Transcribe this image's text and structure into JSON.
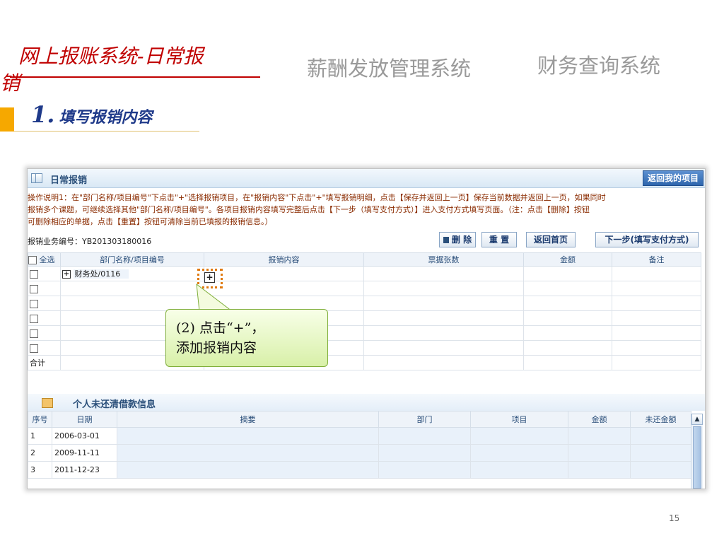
{
  "slide": {
    "title_line1": "网上报账系统-日常报",
    "title_line2": "销",
    "tab_salary": "薪酬发放管理系统",
    "tab_finance": "财务查询系统",
    "section_number": "1.",
    "section_title": "填写报销内容",
    "page_number": "15"
  },
  "panel": {
    "title": "日常报销",
    "return_button": "返回我的项目",
    "instructions": [
      "操作说明1：在\"部门名称/项目编号\"下点击\"+\"选择报销项目，在\"报销内容\"下点击\"+\"填写报销明细，点击【保存并返回上一页】保存当前数据并返回上一页，如果同时",
      "报销多个课题，可继续选择其他\"部门名称/项目编号\"。各项目报销内容填写完整后点击【下一步（填写支付方式）】进入支付方式填写页面。（注：点击【删除】按钮",
      "可删除相应的单据，点击【重置】按钮可清除当前已填报的报销信息。）"
    ],
    "business_no_label": "报销业务编号：",
    "business_no": "YB201303180016",
    "buttons": {
      "delete": "删 除",
      "reset": "重 置",
      "home": "返回首页",
      "next": "下一步(填写支付方式)"
    },
    "table": {
      "select_all": "全选",
      "headers": [
        "部门名称/项目编号",
        "报销内容",
        "票据张数",
        "金额",
        "备注"
      ],
      "first_row_dept": "财务处/0116",
      "total_label": "合计"
    }
  },
  "loan": {
    "title": "个人未还清借款信息",
    "headers": [
      "序号",
      "日期",
      "摘要",
      "部门",
      "项目",
      "金额",
      "未还金额"
    ],
    "rows": [
      {
        "no": "1",
        "date": "2006-03-01"
      },
      {
        "no": "2",
        "date": "2009-11-11"
      },
      {
        "no": "3",
        "date": "2011-12-23"
      }
    ]
  },
  "callout": {
    "line1": "(2) 点击“+”，",
    "line2": "添加报销内容"
  },
  "colors": {
    "title_red": "#c00000",
    "section_blue": "#1f3a8a",
    "accent_orange": "#f6a800",
    "highlight_orange": "#e07a10",
    "callout_green": "#d8f0a8"
  }
}
